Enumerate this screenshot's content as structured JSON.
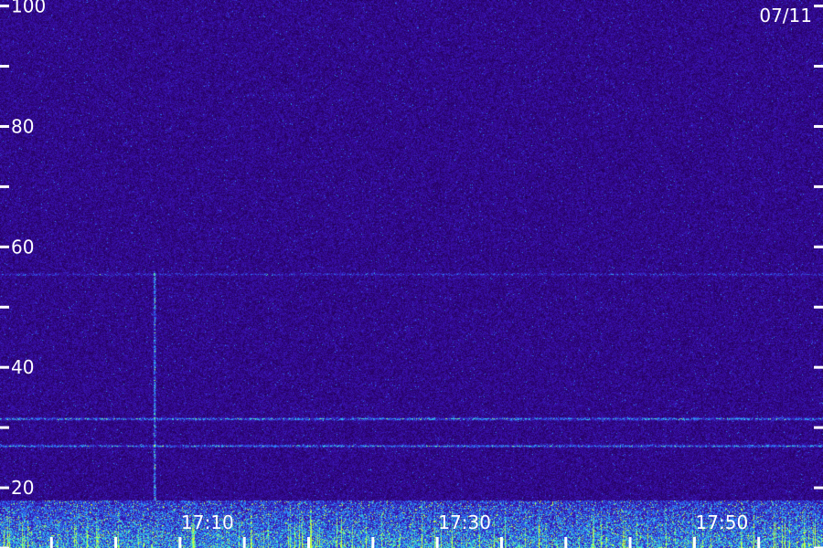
{
  "chart_data": {
    "type": "heatmap",
    "title": "",
    "date_label": "07/11",
    "xlabel": "",
    "ylabel": "",
    "ylim": [
      10,
      101
    ],
    "xlim": [
      "16:56",
      "18:00"
    ],
    "y_ticks": [
      {
        "value": 100,
        "label": "100"
      },
      {
        "value": 90,
        "label": ""
      },
      {
        "value": 80,
        "label": "80"
      },
      {
        "value": 70,
        "label": ""
      },
      {
        "value": 60,
        "label": "60"
      },
      {
        "value": 50,
        "label": ""
      },
      {
        "value": 40,
        "label": "40"
      },
      {
        "value": 30,
        "label": ""
      },
      {
        "value": 20,
        "label": "20"
      },
      {
        "value": 10,
        "label": ""
      }
    ],
    "x_labels": [
      {
        "time": "17:10",
        "label": "17:10"
      },
      {
        "time": "17:30",
        "label": "17:30"
      },
      {
        "time": "17:50",
        "label": "17:50"
      }
    ],
    "x_minor_ticks": [
      "17:00",
      "17:05",
      "17:10",
      "17:15",
      "17:20",
      "17:25",
      "17:30",
      "17:35",
      "17:40",
      "17:45",
      "17:50",
      "17:55"
    ],
    "features": [
      {
        "kind": "band",
        "y": 31.5,
        "intensity": 0.55
      },
      {
        "kind": "band",
        "y": 27,
        "intensity": 0.5
      },
      {
        "kind": "band",
        "y": 55.5,
        "intensity": 0.25
      },
      {
        "kind": "low-noise",
        "y_from": 10,
        "y_to": 18,
        "intensity": 0.85
      },
      {
        "kind": "spike",
        "time": "17:08",
        "y_from": 18,
        "y_to": 56,
        "intensity": 0.7
      }
    ],
    "colors": {
      "background": "#24005a",
      "low": "#3a10b0",
      "mid": "#2a7bff",
      "high": "#3ff0c8",
      "peak": "#c8ff40",
      "tick": "#ffffff"
    }
  }
}
